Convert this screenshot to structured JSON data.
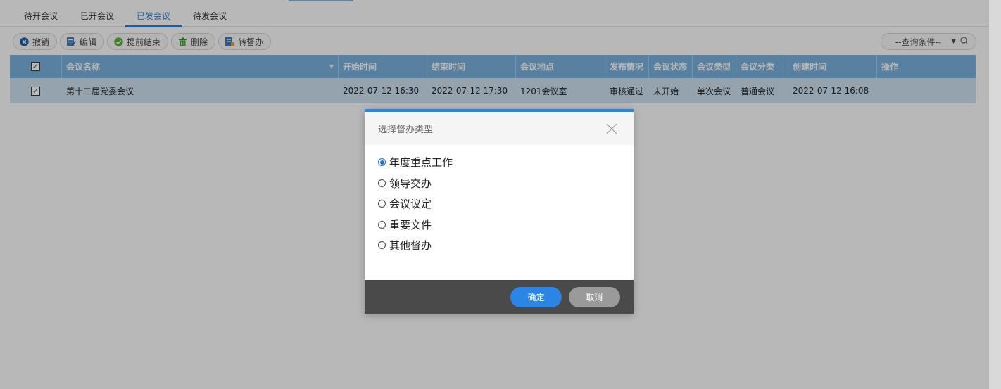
{
  "tabs": [
    {
      "label": "待开会议",
      "active": false
    },
    {
      "label": "已开会议",
      "active": false
    },
    {
      "label": "已发会议",
      "active": true
    },
    {
      "label": "待发会议",
      "active": false
    }
  ],
  "toolbar": {
    "buttons": [
      {
        "label": "撤销",
        "icon": "revoke-icon"
      },
      {
        "label": "编辑",
        "icon": "edit-icon"
      },
      {
        "label": "提前结束",
        "icon": "finish-icon"
      },
      {
        "label": "删除",
        "icon": "delete-icon"
      },
      {
        "label": "转督办",
        "icon": "transfer-icon"
      }
    ],
    "search": {
      "selected": "--查询条件--"
    }
  },
  "table": {
    "columns": [
      "会议名称",
      "开始时间",
      "结束时间",
      "会议地点",
      "发布情况",
      "会议状态",
      "会议类型",
      "会议分类",
      "创建时间",
      "操作"
    ],
    "rows": [
      {
        "checked": true,
        "cells": [
          "第十二届党委会议",
          "2022-07-12 16:30",
          "2022-07-12 17:30",
          "1201会议室",
          "审核通过",
          "未开始",
          "单次会议",
          "普通会议",
          "2022-07-12 16:08",
          ""
        ]
      }
    ]
  },
  "dialog": {
    "title": "选择督办类型",
    "options": [
      {
        "label": "年度重点工作",
        "selected": true
      },
      {
        "label": "领导交办",
        "selected": false
      },
      {
        "label": "会议议定",
        "selected": false
      },
      {
        "label": "重要文件",
        "selected": false
      },
      {
        "label": "其他督办",
        "selected": false
      }
    ],
    "ok_label": "确定",
    "cancel_label": "取消"
  },
  "colors": {
    "accent": "#2b85e4",
    "header": "#7ab3df",
    "row_selected": "#cfe2f3",
    "dialog_footer": "#4a4a4a"
  }
}
